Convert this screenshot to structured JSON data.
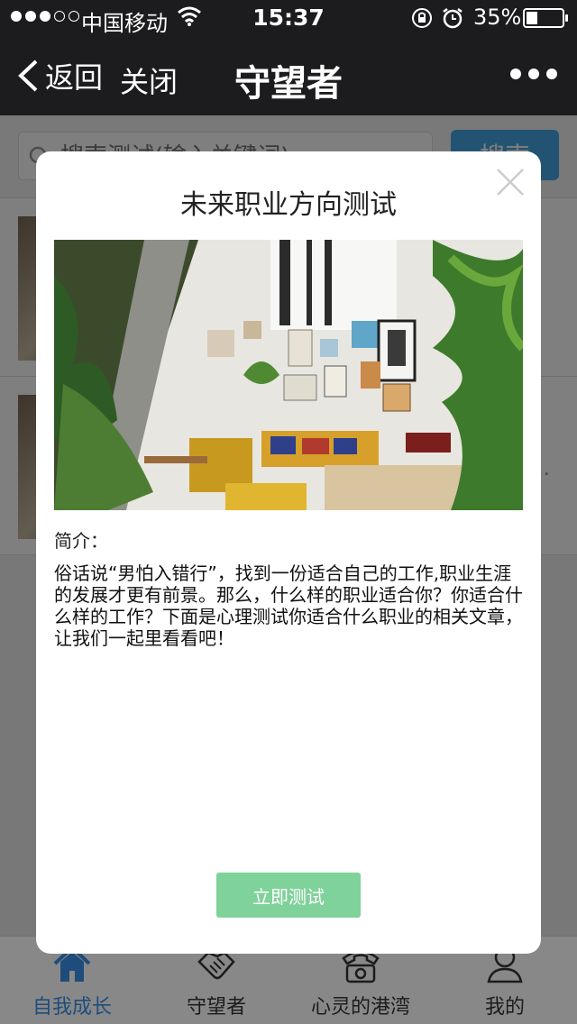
{
  "status_bar": {
    "carrier": "中国移动",
    "time": "15:37",
    "battery": "35%",
    "battery_level": 0.35,
    "icons": [
      "signal-dots-icon",
      "wifi-icon",
      "rotation-lock-icon",
      "alarm-icon",
      "battery-icon"
    ]
  },
  "nav": {
    "back_label": "返回",
    "close_label": "关闭",
    "title": "守望者",
    "more_icon": "more-dots-icon"
  },
  "search": {
    "placeholder": "搜索测试(输入关键词)",
    "button_label": "搜索"
  },
  "list": {
    "items": [
      {
        "label": "",
        "meta": ""
      },
      {
        "label": "",
        "meta": "…"
      }
    ]
  },
  "tabs": [
    {
      "label": "自我成长",
      "icon": "home-icon",
      "active": true
    },
    {
      "label": "守望者",
      "icon": "handshake-icon",
      "active": false
    },
    {
      "label": "心灵的港湾",
      "icon": "telephone-icon",
      "active": false
    },
    {
      "label": "我的",
      "icon": "person-icon",
      "active": false
    }
  ],
  "modal": {
    "title": "未来职业方向测试",
    "intro_label": "简介：",
    "intro_text": "俗话说“男怕入错行”，找到一份适合自己的工作,职业生涯的发展才更有前景。那么，什么样的职业适合你？你适合什么样的工作？下面是心理测试你适合什么职业的相关文章，让我们一起里看看吧！",
    "start_label": "立即测试",
    "close_icon": "close-icon",
    "image": "living-room-photo"
  },
  "colors": {
    "status_bg": "#1c1c1e",
    "accent_blue": "#3a8de0",
    "search_button": "#47a6e5",
    "start_button": "#7fd29a"
  }
}
